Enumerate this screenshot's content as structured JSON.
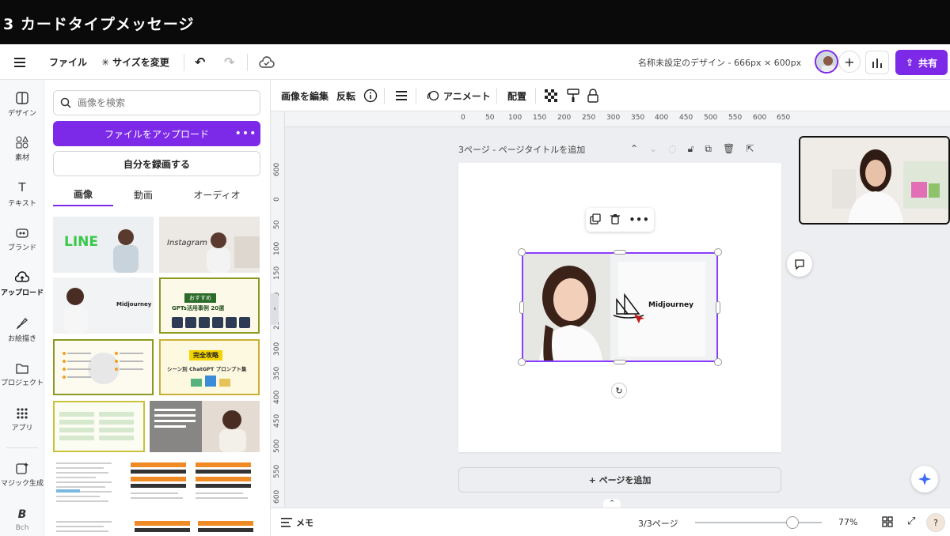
{
  "video_title": "3 カードタイプメッセージ",
  "topbar": {
    "file_label": "ファイル",
    "resize_label": "サイズを変更",
    "doc_title": "名称未設定のデザイン - 666px × 600px",
    "share_label": "共有"
  },
  "rail": [
    {
      "label": "デザイン",
      "icon": "layout-icon"
    },
    {
      "label": "素材",
      "icon": "elements-icon"
    },
    {
      "label": "テキスト",
      "icon": "text-icon"
    },
    {
      "label": "ブランド",
      "icon": "brand-icon"
    },
    {
      "label": "アップロード",
      "icon": "upload-cloud-icon"
    },
    {
      "label": "お絵描き",
      "icon": "draw-icon"
    },
    {
      "label": "プロジェクト",
      "icon": "folder-icon"
    },
    {
      "label": "アプリ",
      "icon": "apps-icon"
    },
    {
      "label": "マジック生成",
      "icon": "magic-icon"
    },
    {
      "label": "Bch",
      "icon": "bchunk-icon"
    }
  ],
  "panel": {
    "search_placeholder": "画像を検索",
    "upload_label": "ファイルをアップロード",
    "record_label": "自分を録画する",
    "tabs": [
      "画像",
      "動画",
      "オーディオ"
    ],
    "thumbs": {
      "line": "LINE",
      "instagram": "Instagram",
      "midjourney": "Midjourney",
      "recommend_badge": "おすすめ",
      "gpts_title": "GPTs活用事例 20選",
      "kanzen_badge": "完全攻略",
      "chatgpt_prompt": "シーン別 ChatGPT プロンプト集"
    }
  },
  "context_toolbar": {
    "edit_image": "画像を編集",
    "flip": "反転",
    "animate": "アニメート",
    "position": "配置"
  },
  "ruler_h": [
    "0",
    "50",
    "100",
    "150",
    "200",
    "250",
    "300",
    "350",
    "400",
    "450",
    "500",
    "550",
    "600",
    "650"
  ],
  "ruler_v": [
    "600",
    "0",
    "50",
    "100",
    "150",
    "200",
    "250",
    "300",
    "350",
    "400",
    "450",
    "500",
    "550",
    "600"
  ],
  "page": {
    "header": "3ページ - ページタイトルを追加",
    "image_text": "Midjourney"
  },
  "add_page_label": "+ ページを追加",
  "bottom": {
    "notes_label": "メモ",
    "page_count": "3/3ページ",
    "zoom": "77%",
    "zoom_level": 0.77
  },
  "colors": {
    "accent": "#7d2ae8",
    "selection": "#8b3dff"
  }
}
